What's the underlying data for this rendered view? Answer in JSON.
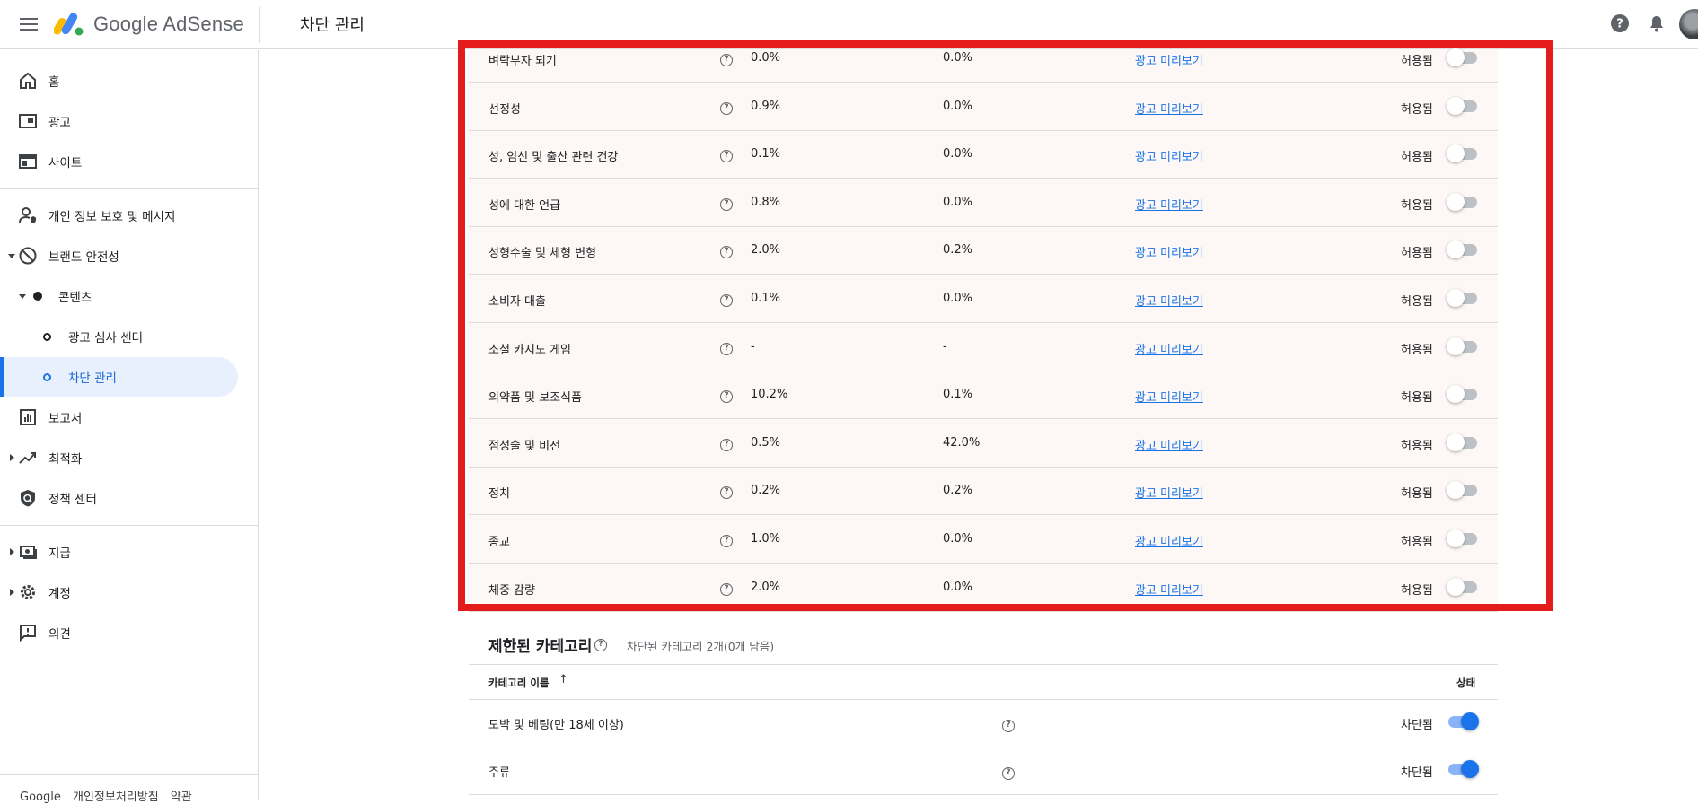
{
  "header": {
    "brand": "Google AdSense",
    "page_title": "차단 관리"
  },
  "sidebar": {
    "items": [
      {
        "label": "홈"
      },
      {
        "label": "광고"
      },
      {
        "label": "사이트"
      },
      {
        "label": "개인 정보 보호 및 메시지"
      },
      {
        "label": "브랜드 안전성"
      },
      {
        "label": "콘텐츠"
      },
      {
        "label": "광고 심사 센터"
      },
      {
        "label": "차단 관리"
      },
      {
        "label": "보고서"
      },
      {
        "label": "최적화"
      },
      {
        "label": "정책 센터"
      },
      {
        "label": "지급"
      },
      {
        "label": "계정"
      },
      {
        "label": "의견"
      }
    ],
    "footer": [
      "Google",
      "개인정보처리방침",
      "약관"
    ]
  },
  "categories": {
    "link_label": "광고 미리보기",
    "rows": [
      {
        "name": "벼락부자 되기",
        "v1": "0.0%",
        "v2": "0.0%",
        "status": "허용됨"
      },
      {
        "name": "선정성",
        "v1": "0.9%",
        "v2": "0.0%",
        "status": "허용됨"
      },
      {
        "name": "성, 임신 및 출산 관련 건강",
        "v1": "0.1%",
        "v2": "0.0%",
        "status": "허용됨"
      },
      {
        "name": "성에 대한 언급",
        "v1": "0.8%",
        "v2": "0.0%",
        "status": "허용됨"
      },
      {
        "name": "성형수술 및 체형 변형",
        "v1": "2.0%",
        "v2": "0.2%",
        "status": "허용됨"
      },
      {
        "name": "소비자 대출",
        "v1": "0.1%",
        "v2": "0.0%",
        "status": "허용됨"
      },
      {
        "name": "소셜 카지노 게임",
        "v1": "-",
        "v2": "-",
        "status": "허용됨"
      },
      {
        "name": "의약품 및 보조식품",
        "v1": "10.2%",
        "v2": "0.1%",
        "status": "허용됨"
      },
      {
        "name": "점성술 및 비전",
        "v1": "0.5%",
        "v2": "42.0%",
        "status": "허용됨"
      },
      {
        "name": "정치",
        "v1": "0.2%",
        "v2": "0.2%",
        "status": "허용됨"
      },
      {
        "name": "종교",
        "v1": "1.0%",
        "v2": "0.0%",
        "status": "허용됨"
      },
      {
        "name": "체중 감량",
        "v1": "2.0%",
        "v2": "0.0%",
        "status": "허용됨"
      }
    ]
  },
  "restricted": {
    "title": "제한된 카테고리",
    "subtitle": "차단된 카테고리 2개(0개 남음)",
    "col_name": "카테고리 이름",
    "col_status": "상태",
    "rows": [
      {
        "name": "도박 및 베팅(만 18세 이상)",
        "status": "차단됨"
      },
      {
        "name": "주류",
        "status": "차단됨"
      }
    ]
  },
  "colors": {
    "accent": "#1a73e8",
    "highlight_frame": "#e31b1b",
    "nav_active_bg": "#e8f0fe"
  }
}
